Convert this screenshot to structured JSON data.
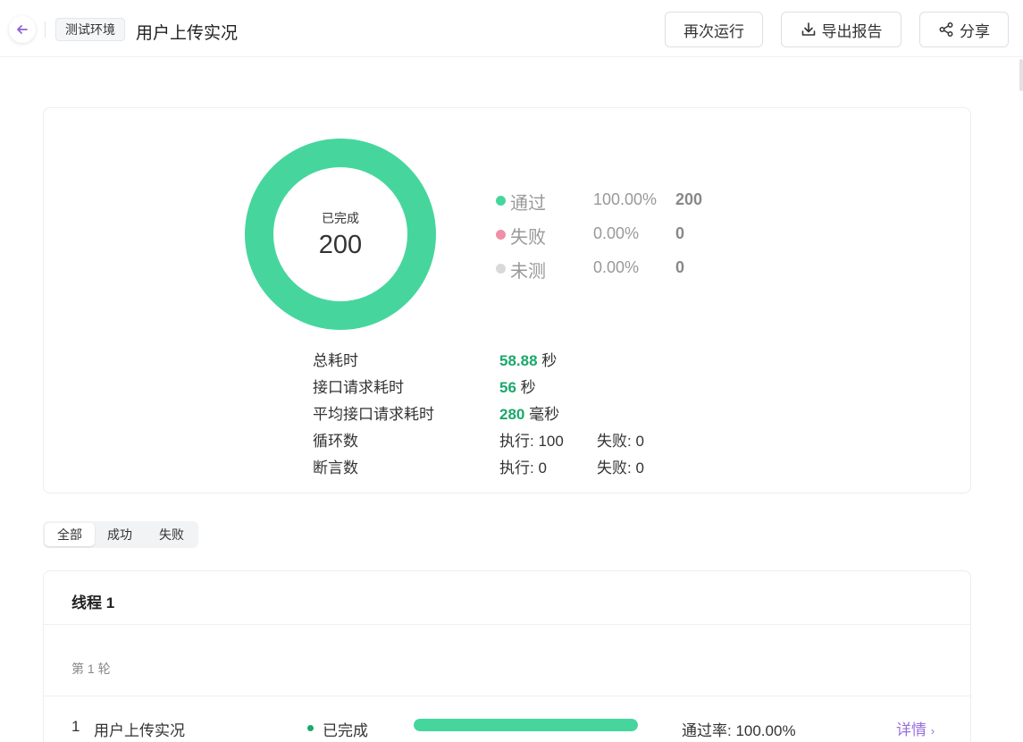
{
  "header": {
    "env_tag": "测试环境",
    "title": "用户上传实况",
    "rerun_label": "再次运行",
    "export_label": "导出报告",
    "share_label": "分享"
  },
  "summary": {
    "center_label": "已完成",
    "center_value": "200",
    "legend": [
      {
        "name": "通过",
        "percent": "100.00%",
        "count": "200",
        "color": "#46d69d",
        "fraction": 1.0
      },
      {
        "name": "失败",
        "percent": "0.00%",
        "count": "0",
        "color": "#f08fa8",
        "fraction": 0.0
      },
      {
        "name": "未测",
        "percent": "0.00%",
        "count": "0",
        "color": "#d9d9d9",
        "fraction": 0.0
      }
    ],
    "stats": [
      {
        "label": "总耗时",
        "value": "58.88",
        "unit": " 秒"
      },
      {
        "label": "接口请求耗时",
        "value": "56",
        "unit": " 秒"
      },
      {
        "label": "平均接口请求耗时",
        "value": "280",
        "unit": " 毫秒"
      }
    ],
    "loops": {
      "label": "循环数",
      "exec": "执行: 100",
      "fail": "失败: 0"
    },
    "asserts": {
      "label": "断言数",
      "exec": "执行: 0",
      "fail": "失败: 0"
    }
  },
  "filters": [
    {
      "label": "全部",
      "active": true
    },
    {
      "label": "成功",
      "active": false
    },
    {
      "label": "失败",
      "active": false
    }
  ],
  "thread": {
    "title": "线程 1",
    "round_label": "第 1 轮",
    "rows": [
      {
        "index": "1",
        "name": "用户上传实况",
        "status": "已完成",
        "progress": 1.0,
        "rate": "通过率: 100.00%",
        "detail": "详情"
      }
    ]
  },
  "colors": {
    "pass": "#46d69d",
    "fail": "#f08fa8",
    "untested": "#d9d9d9",
    "accent": "#9a6fe0",
    "value_green": "#1aa86b"
  }
}
